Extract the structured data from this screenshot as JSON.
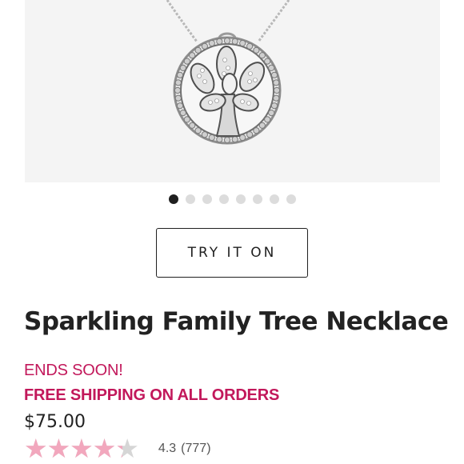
{
  "product": {
    "title": "Sparkling Family Tree Necklace",
    "promo": "ENDS SOON!",
    "shipping": "FREE SHIPPING ON ALL ORDERS",
    "price": "$75.00"
  },
  "gallery": {
    "dots": 8,
    "active_index": 0
  },
  "try_on": {
    "label": "TRY IT ON"
  },
  "rating": {
    "value": "4.3",
    "count": "(777)",
    "fraction": 0.86,
    "stars": "★★★★★"
  },
  "colors": {
    "accent": "#c2185b",
    "star_fill": "#f2a7bd",
    "star_empty": "#d6d6d6"
  }
}
